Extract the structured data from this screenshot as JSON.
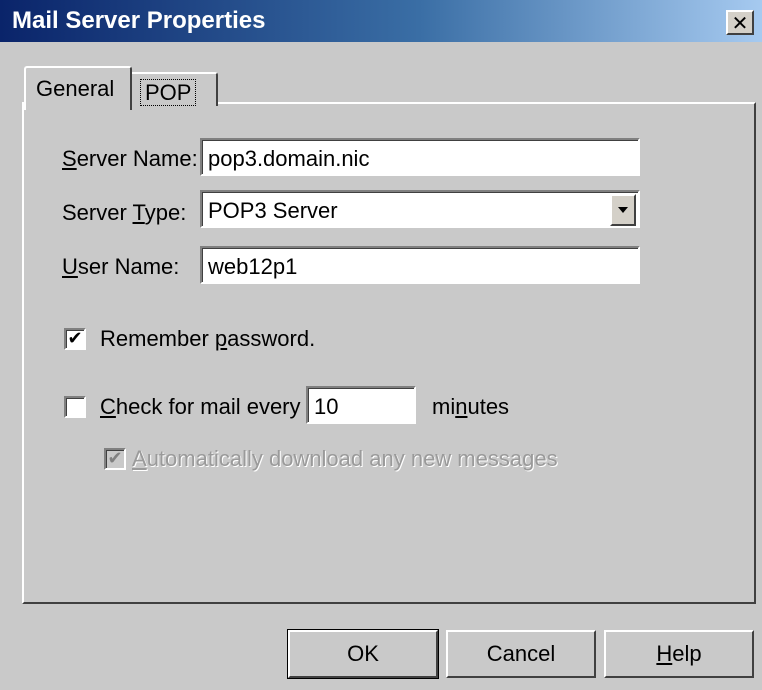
{
  "window": {
    "title": "Mail Server Properties",
    "close_glyph": "✕"
  },
  "tabs": [
    {
      "label": "General",
      "active": true
    },
    {
      "label": "POP",
      "active": false
    }
  ],
  "form": {
    "server_name": {
      "label_pre": "",
      "label_key": "S",
      "label_post": "erver Name:",
      "value": "pop3.domain.nic"
    },
    "server_type": {
      "label_pre": "Server ",
      "label_key": "T",
      "label_post": "ype:",
      "value": "POP3 Server"
    },
    "user_name": {
      "label_pre": "",
      "label_key": "U",
      "label_post": "ser Name:",
      "value": "web12p1"
    },
    "remember_password": {
      "label_pre": "Remember ",
      "label_key": "p",
      "label_post": "assword.",
      "checked": true
    },
    "check_mail": {
      "label_pre": "",
      "label_key": "C",
      "label_post": "heck for mail every",
      "interval": "10",
      "checked": false
    },
    "minutes": {
      "label_pre": "mi",
      "label_key": "n",
      "label_post": "utes"
    },
    "auto_download": {
      "label_pre": "",
      "label_key": "A",
      "label_post": "utomatically download any new messages",
      "checked": true,
      "disabled": true
    }
  },
  "buttons": {
    "ok": "OK",
    "cancel": "Cancel",
    "help_key": "H",
    "help_post": "elp"
  },
  "colors": {
    "title_gradient_start": "#0a246a",
    "dialog_bg": "#c9c9c9"
  }
}
